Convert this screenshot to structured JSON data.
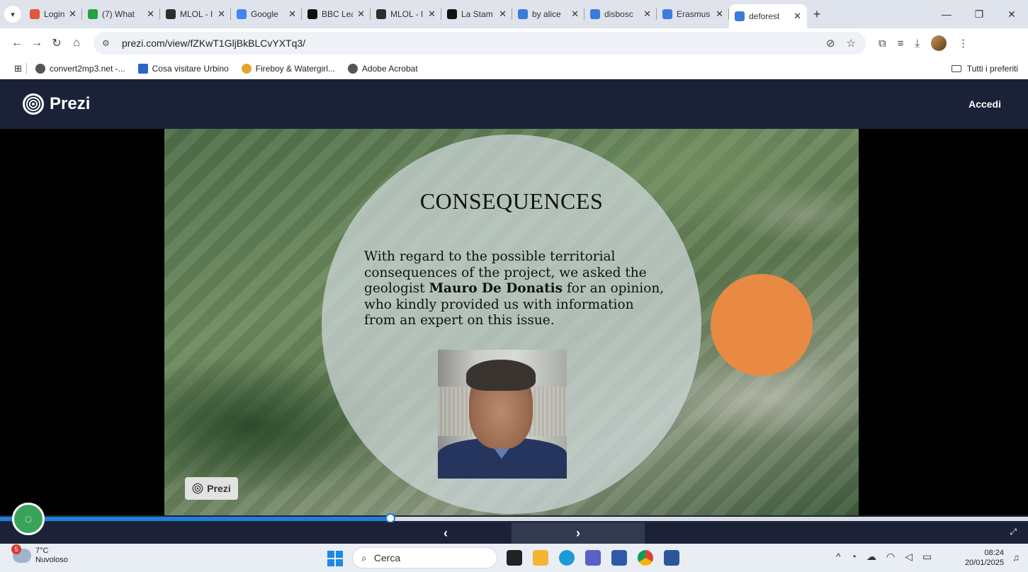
{
  "browser": {
    "tabs": [
      {
        "label": "Login Ar",
        "icon": "dots-icon",
        "color": "#e0573f"
      },
      {
        "label": "(7) What",
        "icon": "whatsapp-icon",
        "color": "#25a244"
      },
      {
        "label": "MLOL - I",
        "icon": "mlol-icon",
        "color": "#2d2d2d"
      },
      {
        "label": "Google",
        "icon": "google-translate-icon",
        "color": "#4285f4"
      },
      {
        "label": "BBC Lea",
        "icon": "bbc-icon",
        "color": "#111111"
      },
      {
        "label": "MLOL - I",
        "icon": "mlol-icon",
        "color": "#2d2d2d"
      },
      {
        "label": "La Stam",
        "icon": "s-icon",
        "color": "#111111"
      },
      {
        "label": "by alice",
        "icon": "prezi-icon",
        "color": "#3b7bdc"
      },
      {
        "label": "disbosc",
        "icon": "prezi-icon",
        "color": "#3b7bdc"
      },
      {
        "label": "Erasmus",
        "icon": "docs-icon",
        "color": "#3d7be0"
      },
      {
        "label": "deforest",
        "icon": "prezi-icon",
        "color": "#3b7bdc",
        "active": true
      }
    ],
    "url": "prezi.com/view/fZKwT1GljBkBLCvYXTq3/",
    "bookmarks": [
      {
        "label": "convert2mp3.net -..."
      },
      {
        "label": "Cosa visitare Urbino"
      },
      {
        "label": "Fireboy & Watergirl..."
      },
      {
        "label": "Adobe Acrobat"
      }
    ],
    "all_bookmarks": "Tutti i preferiti"
  },
  "prezi": {
    "brand": "Prezi",
    "login": "Accedi",
    "slide": {
      "title": "CONSEQUENCES",
      "text_before": "With regard to the possible territorial consequences of the project, we asked the geologist ",
      "text_bold": "Mauro De Donatis",
      "text_after": " for an opinion, who kindly provided us with information from an expert on this issue."
    },
    "badge": "Prezi",
    "progress": 0.38,
    "accent": "#1e7fe0"
  },
  "taskbar": {
    "temp": "7°C",
    "condition": "Nuvoloso",
    "notifications": "5",
    "search": "Cerca",
    "time": "08:24",
    "date": "20/01/2025"
  }
}
